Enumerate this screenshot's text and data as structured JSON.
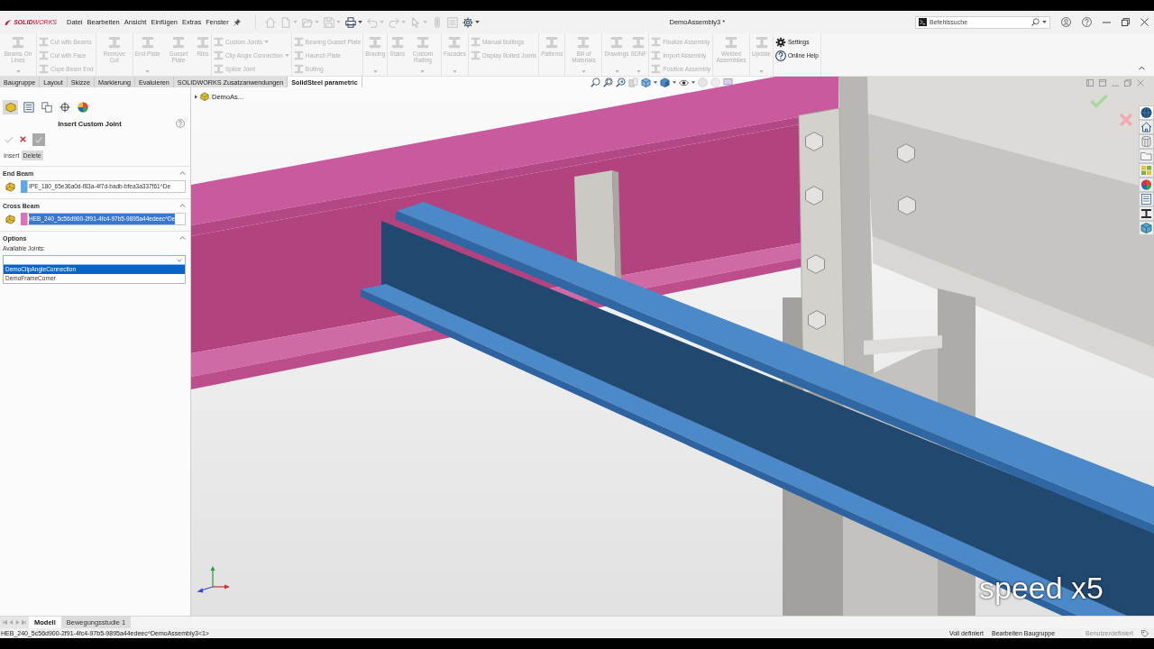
{
  "title_bar": {
    "logo": "**SOLID**WORKS",
    "menus": [
      "Datei",
      "Bearbeiten",
      "Ansicht",
      "Einfügen",
      "Extras",
      "Fenster"
    ],
    "document_title": "DemoAssembly3 *",
    "search": {
      "placeholder": "Befehlssuche"
    }
  },
  "quick_access": [
    {
      "kind": "home",
      "disabled": true,
      "dropdown": false
    },
    {
      "kind": "new",
      "disabled": true,
      "dropdown": true
    },
    {
      "kind": "open",
      "disabled": true,
      "dropdown": true
    },
    {
      "kind": "save",
      "disabled": true,
      "dropdown": true
    },
    {
      "kind": "print",
      "disabled": false,
      "dropdown": true
    },
    {
      "kind": "undo",
      "disabled": true,
      "dropdown": true
    },
    {
      "kind": "redo",
      "disabled": true,
      "dropdown": true
    },
    {
      "kind": "select",
      "disabled": true,
      "dropdown": true
    },
    {
      "kind": "rebuild",
      "disabled": true,
      "dropdown": false
    },
    {
      "kind": "properties",
      "disabled": true,
      "dropdown": false
    },
    {
      "kind": "options",
      "disabled": false,
      "dropdown": true
    }
  ],
  "ribbon": {
    "expanded": true,
    "groups": [
      {
        "kind": "large",
        "items": [
          {
            "kind": "tool",
            "label": "Beams On Lines",
            "disabled": true,
            "dropdown": true
          }
        ]
      },
      {
        "kind": "stack",
        "items": [
          {
            "kind": "tool",
            "label": "Cut with Beams",
            "disabled": true,
            "dropdown": false
          },
          {
            "kind": "tool",
            "label": "Cut with Face",
            "disabled": true,
            "dropdown": false
          },
          {
            "kind": "tool",
            "label": "Cope Beam End",
            "disabled": true,
            "dropdown": false
          }
        ]
      },
      {
        "kind": "large",
        "items": [
          {
            "kind": "tool",
            "label": "Remove Cut",
            "disabled": true,
            "dropdown": false
          }
        ]
      },
      {
        "kind": "large",
        "items": [
          {
            "kind": "tool",
            "label": "End Plate",
            "disabled": true,
            "dropdown": true
          },
          {
            "kind": "tool",
            "label": "Gusset Plate",
            "disabled": true,
            "dropdown": false
          },
          {
            "kind": "tool",
            "label": "Ribs",
            "disabled": true,
            "dropdown": false
          }
        ]
      },
      {
        "kind": "stack",
        "items": [
          {
            "kind": "tool",
            "label": "Custom Joints",
            "disabled": true,
            "dropdown": true
          },
          {
            "kind": "tool",
            "label": "Clip Angle Connection",
            "disabled": true,
            "dropdown": true
          },
          {
            "kind": "tool",
            "label": "Splice Joint",
            "disabled": true,
            "dropdown": false
          }
        ]
      },
      {
        "kind": "stack",
        "items": [
          {
            "kind": "tool",
            "label": "Bearing Gusset Plate",
            "disabled": true,
            "dropdown": false
          },
          {
            "kind": "tool",
            "label": "Haunch Plate",
            "disabled": true,
            "dropdown": false
          },
          {
            "kind": "tool",
            "label": "Bolting",
            "disabled": true,
            "dropdown": false
          }
        ]
      },
      {
        "kind": "large",
        "items": [
          {
            "kind": "tool",
            "label": "Bracing",
            "disabled": true,
            "dropdown": true
          }
        ]
      },
      {
        "kind": "large",
        "items": [
          {
            "kind": "tool",
            "label": "Stairs",
            "disabled": true,
            "dropdown": false
          },
          {
            "kind": "tool",
            "label": "Custom Railing",
            "disabled": true,
            "dropdown": true
          }
        ]
      },
      {
        "kind": "large",
        "items": [
          {
            "kind": "tool",
            "label": "Facades",
            "disabled": true,
            "dropdown": true
          }
        ]
      },
      {
        "kind": "stack",
        "items": [
          {
            "kind": "tool",
            "label": "Manual Boltings",
            "disabled": true,
            "dropdown": false
          },
          {
            "kind": "tool",
            "label": "Display Bolted Joints",
            "disabled": true,
            "dropdown": false
          }
        ]
      },
      {
        "kind": "large",
        "items": [
          {
            "kind": "tool",
            "label": "Patterns",
            "disabled": true,
            "dropdown": false
          }
        ]
      },
      {
        "kind": "large",
        "items": [
          {
            "kind": "tool",
            "label": "Bill of Materials",
            "disabled": true,
            "dropdown": true
          }
        ]
      },
      {
        "kind": "large",
        "items": [
          {
            "kind": "tool",
            "label": "Drawings",
            "disabled": true,
            "dropdown": true
          },
          {
            "kind": "tool",
            "label": "SDNF",
            "disabled": true,
            "dropdown": true
          }
        ]
      },
      {
        "kind": "stack",
        "items": [
          {
            "kind": "tool",
            "label": "Finalize Assembly",
            "disabled": true,
            "dropdown": false
          },
          {
            "kind": "tool",
            "label": "Import Assembly",
            "disabled": true,
            "dropdown": false
          },
          {
            "kind": "tool",
            "label": "Position Assembly",
            "disabled": true,
            "dropdown": false
          }
        ]
      },
      {
        "kind": "large",
        "items": [
          {
            "kind": "tool",
            "label": "Welded Assemblies",
            "disabled": true,
            "dropdown": false
          }
        ]
      },
      {
        "kind": "large",
        "items": [
          {
            "kind": "tool",
            "label": "Update",
            "disabled": true,
            "dropdown": true
          }
        ]
      },
      {
        "kind": "stack",
        "items": [
          {
            "kind": "settings",
            "label": "Settings",
            "disabled": false,
            "dropdown": false
          },
          {
            "kind": "help",
            "label": "Online Help",
            "disabled": false,
            "dropdown": false
          }
        ]
      }
    ]
  },
  "command_tabs": [
    {
      "label": "Baugruppe",
      "selected": false
    },
    {
      "label": "Layout",
      "selected": false
    },
    {
      "label": "Skizze",
      "selected": false
    },
    {
      "label": "Markierung",
      "selected": false
    },
    {
      "label": "Evaluieren",
      "selected": false
    },
    {
      "label": "SOLIDWORKS Zusatzanwendungen",
      "selected": false
    },
    {
      "label": "SolidSteel parametric",
      "selected": true
    }
  ],
  "property_manager": {
    "tabs": [
      {
        "kind": "feature_tree",
        "selected": true
      },
      {
        "kind": "properties",
        "selected": false
      },
      {
        "kind": "configurations",
        "selected": false
      },
      {
        "kind": "dimxpert",
        "selected": false
      },
      {
        "kind": "display",
        "selected": false
      }
    ],
    "title": "Insert Custom Joint",
    "actions": [
      {
        "kind": "ok",
        "disabled": true
      },
      {
        "kind": "cancel",
        "disabled": false
      },
      {
        "kind": "preview",
        "disabled": true
      }
    ],
    "mode_tabs": [
      {
        "label": "Insert",
        "selected": true
      },
      {
        "label": "Delete",
        "selected": false
      }
    ],
    "selections": [
      {
        "title": "End Beam",
        "expanded": true,
        "value": "IPE_180_65e36a0d-f83a-4f7d-badb-bfea3a337f61^De",
        "color": "#5ea6e8",
        "highlighted": false
      },
      {
        "title": "Cross Beam",
        "expanded": true,
        "value": "HEB_240_5c56d900-2f91-4fc4-97b5-9895a44edeec^De",
        "color": "#e070bf",
        "highlighted": true
      }
    ],
    "options": {
      "title": "Options",
      "expanded": true,
      "label": "Available Joints:",
      "choices": [
        {
          "label": "DemoClipAngleConnection",
          "selected": true
        },
        {
          "label": "DemoFrameCorner",
          "selected": false
        }
      ]
    }
  },
  "viewport": {
    "tree_item": "DemoAs...",
    "overlay_text": "speed x5"
  },
  "bottom_tabs": [
    {
      "label": "Modell",
      "selected": true
    },
    {
      "label": "Bewegungsstudie 1",
      "selected": false
    }
  ],
  "status_bar": {
    "selection": "HEB_240_5c56d900-2f91-4fc4-97b5-9895a44edeec^DemoAssembly3<1>",
    "items": [
      {
        "text": "Voll definiert",
        "disabled": false
      },
      {
        "text": "Bearbeiten Baugruppe",
        "disabled": false
      },
      {
        "text": "Benutzerdefiniert",
        "disabled": true
      }
    ]
  }
}
